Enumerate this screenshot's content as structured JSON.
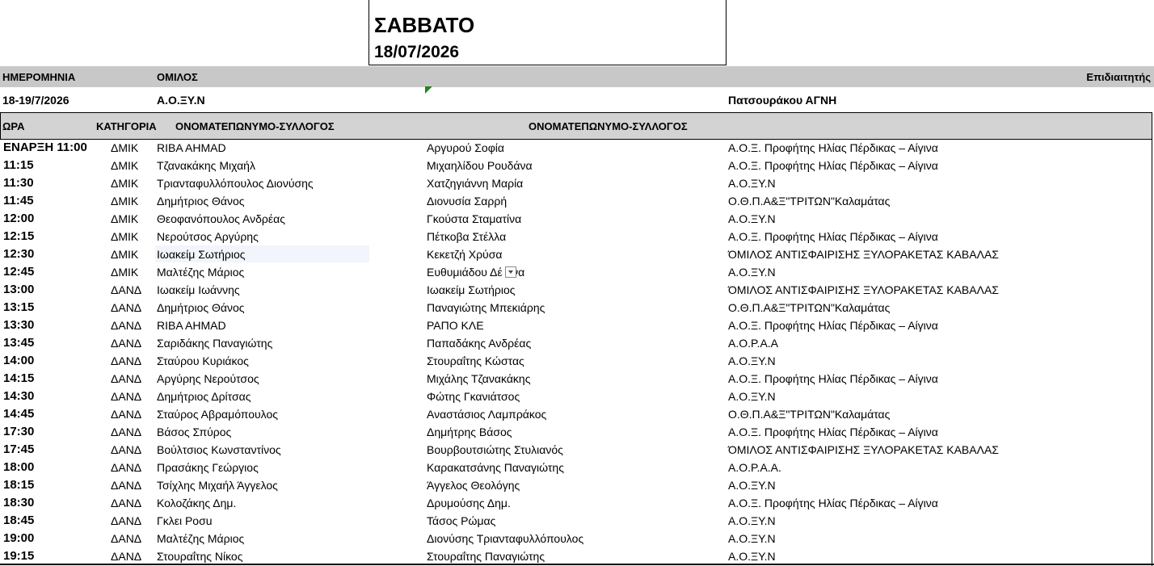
{
  "title": {
    "day": "ΣΑΒΒΑΤΟ",
    "date": "18/07/2026"
  },
  "info_header": {
    "date_label": "ΗΜΕΡΟΜΗΝΙΑ",
    "group_label": "ΟΜΙΛΟΣ",
    "referee_label": "Επιδιαιτητής"
  },
  "info_values": {
    "date": "18-19/7/2026",
    "group": "Α.Ο.ΞΥ.Ν",
    "referee": "Πατσουράκου ΑΓΝΗ"
  },
  "columns": {
    "time": "ΩΡΑ",
    "category": "ΚΑΤΗΓΟΡΙΑ",
    "player1": "ΟΝΟΜΑΤΕΠΩΝΥΜΟ-ΣΥΛΛΟΓΟΣ",
    "player2": "ΟΝΟΜΑΤΕΠΩΝΥΜΟ-ΣΥΛΛΟΓΟΣ"
  },
  "rows": [
    {
      "time": "ΕΝΑΡΞΗ  11:00",
      "category": "ΔΜΙΚ",
      "player1": "RIBA AHMAD",
      "player2": "Αργυρού Σοφία",
      "club": "Α.Ο.Ξ. Προφήτης Ηλίας Πέρδικας – Αίγινα"
    },
    {
      "time": "11:15",
      "category": "ΔΜΙΚ",
      "player1": "Τζανακάκης Μιχαήλ",
      "player2": "Μιχαηλίδου Ρουδάνα",
      "club": "Α.Ο.Ξ. Προφήτης Ηλίας Πέρδικας – Αίγινα"
    },
    {
      "time": "11:30",
      "category": "ΔΜΙΚ",
      "player1": "Τριανταφυλλόπουλος Διονύσης",
      "player2": "Χατζηγιάννη Μαρία",
      "club": "Α.Ο.ΞΥ.Ν"
    },
    {
      "time": "11:45",
      "category": "ΔΜΙΚ",
      "player1": "Δημήτριος Θάνος",
      "player2": "Διονυσία Σαρρή",
      "club": "Ο.Θ.Π.Α&Ξ\"ΤΡΙΤΩΝ\"Καλαμάτας"
    },
    {
      "time": "12:00",
      "category": "ΔΜΙΚ",
      "player1": "Θεοφανόπουλος Ανδρέας",
      "player2": "Γκούστα Σταματίνα",
      "club": "Α.Ο.ΞΥ.Ν"
    },
    {
      "time": "12:15",
      "category": "ΔΜΙΚ",
      "player1": "Νερούτσος Αργύρης",
      "player2": "Πέτκοβα Στέλλα",
      "club": "Α.Ο.Ξ. Προφήτης Ηλίας Πέρδικας – Αίγινα"
    },
    {
      "time": "12:30",
      "category": "ΔΜΙΚ",
      "player1": "Ιωακείμ Σωτήριος",
      "player2": "Κεκετζή Χρύσα",
      "club": "ΌΜΙΛΟΣ ΑΝΤΙΣΦΑΙΡΙΣΗΣ ΞΥΛΟΡΑΚΕΤΑΣ ΚΑΒΑΛΑΣ"
    },
    {
      "time": "12:45",
      "category": "ΔΜΙΚ",
      "player1": "Μαλτέζης Μάριος",
      "player2": "Ευθυμιάδου Δέ  τινα",
      "club": "Α.Ο.ΞΥ.Ν"
    },
    {
      "time": "13:00",
      "category": "ΔΑΝΔ",
      "player1": "Ιωακείμ Ιωάννης",
      "player2": "Ιωακείμ Σωτήριος",
      "club": "ΌΜΙΛΟΣ ΑΝΤΙΣΦΑΙΡΙΣΗΣ ΞΥΛΟΡΑΚΕΤΑΣ ΚΑΒΑΛΑΣ"
    },
    {
      "time": "13:15",
      "category": "ΔΑΝΔ",
      "player1": "Δημήτριος Θάνος",
      "player2": "Παναγιώτης Μπεκιάρης",
      "club": "Ο.Θ.Π.Α&Ξ\"ΤΡΙΤΩΝ\"Καλαμάτας"
    },
    {
      "time": "13:30",
      "category": "ΔΑΝΔ",
      "player1": "RIBA AHMAD",
      "player2": "ΡΑΠΟ ΚΛΕ",
      "club": "Α.Ο.Ξ. Προφήτης Ηλίας Πέρδικας – Αίγινα"
    },
    {
      "time": "13:45",
      "category": "ΔΑΝΔ",
      "player1": "Σαριδάκης Παναγιώτης",
      "player2": "Παπαδάκης Ανδρέας",
      "club": "Α.Ο.Ρ.Α.Α"
    },
    {
      "time": "14:00",
      "category": "ΔΑΝΔ",
      "player1": "Σταύρου Κυριάκος",
      "player2": "Στουραΐτης Κώστας",
      "club": "Α.Ο.ΞΥ.Ν"
    },
    {
      "time": "14:15",
      "category": "ΔΑΝΔ",
      "player1": "Αργύρης Νερούτσος",
      "player2": "Μιχάλης Τζανακάκης",
      "club": "Α.Ο.Ξ. Προφήτης Ηλίας Πέρδικας – Αίγινα"
    },
    {
      "time": "14:30",
      "category": "ΔΑΝΔ",
      "player1": "Δημήτριος Δρίτσας",
      "player2": "Φώτης Γκανιάτσος",
      "club": "Α.Ο.ΞΥ.Ν"
    },
    {
      "time": "14:45",
      "category": "ΔΑΝΔ",
      "player1": "Σταύρος Αβραμόπουλος",
      "player2": "Αναστάσιος Λαμπράκος",
      "club": "Ο.Θ.Π.Α&Ξ\"ΤΡΙΤΩΝ\"Καλαμάτας"
    },
    {
      "time": "17:30",
      "category": "ΔΑΝΔ",
      "player1": "Βάσος Σπύρος",
      "player2": "Δημήτρης Βάσος",
      "club": "Α.Ο.Ξ. Προφήτης Ηλίας Πέρδικας – Αίγινα"
    },
    {
      "time": "17:45",
      "category": "ΔΑΝΔ",
      "player1": "Βούλτσιος Κωνσταντίνος",
      "player2": "Βουρβουτσιώτης Στυλιανός",
      "club": "ΌΜΙΛΟΣ ΑΝΤΙΣΦΑΙΡΙΣΗΣ ΞΥΛΟΡΑΚΕΤΑΣ ΚΑΒΑΛΑΣ"
    },
    {
      "time": "18:00",
      "category": "ΔΑΝΔ",
      "player1": "Πρασάκης Γεώργιος",
      "player2": "Καρακατσάνης Παναγιώτης",
      "club": "Α.Ο.Ρ.Α.Α."
    },
    {
      "time": "18:15",
      "category": "ΔΑΝΔ",
      "player1": "Τσίχλης Μιχαήλ Άγγελος",
      "player2": "Άγγελος Θεολόγης",
      "club": "Α.Ο.ΞΥ.Ν"
    },
    {
      "time": "18:30",
      "category": "ΔΑΝΔ",
      "player1": "Κολοζάκης Δημ.",
      "player2": "Δρυμούσης Δημ.",
      "club": "Α.Ο.Ξ. Προφήτης Ηλίας Πέρδικας – Αίγινα"
    },
    {
      "time": "18:45",
      "category": "ΔΑΝΔ",
      "player1": "Γκλει Ρoσu",
      "player2": "Τάσος Ρώμας",
      "club": "Α.Ο.ΞΥ.Ν"
    },
    {
      "time": "19:00",
      "category": "ΔΑΝΔ",
      "player1": "Μαλτέζης Μάριος",
      "player2": "Διονύσης Τριανταφυλλόπουλος",
      "club": "Α.Ο.ΞΥ.Ν"
    },
    {
      "time": "19:15",
      "category": "ΔΑΝΔ",
      "player1": "Στουραΐτης Νίκος",
      "player2": "Στουραΐτης Παναγιώτης",
      "club": "Α.Ο.ΞΥ.Ν"
    }
  ]
}
